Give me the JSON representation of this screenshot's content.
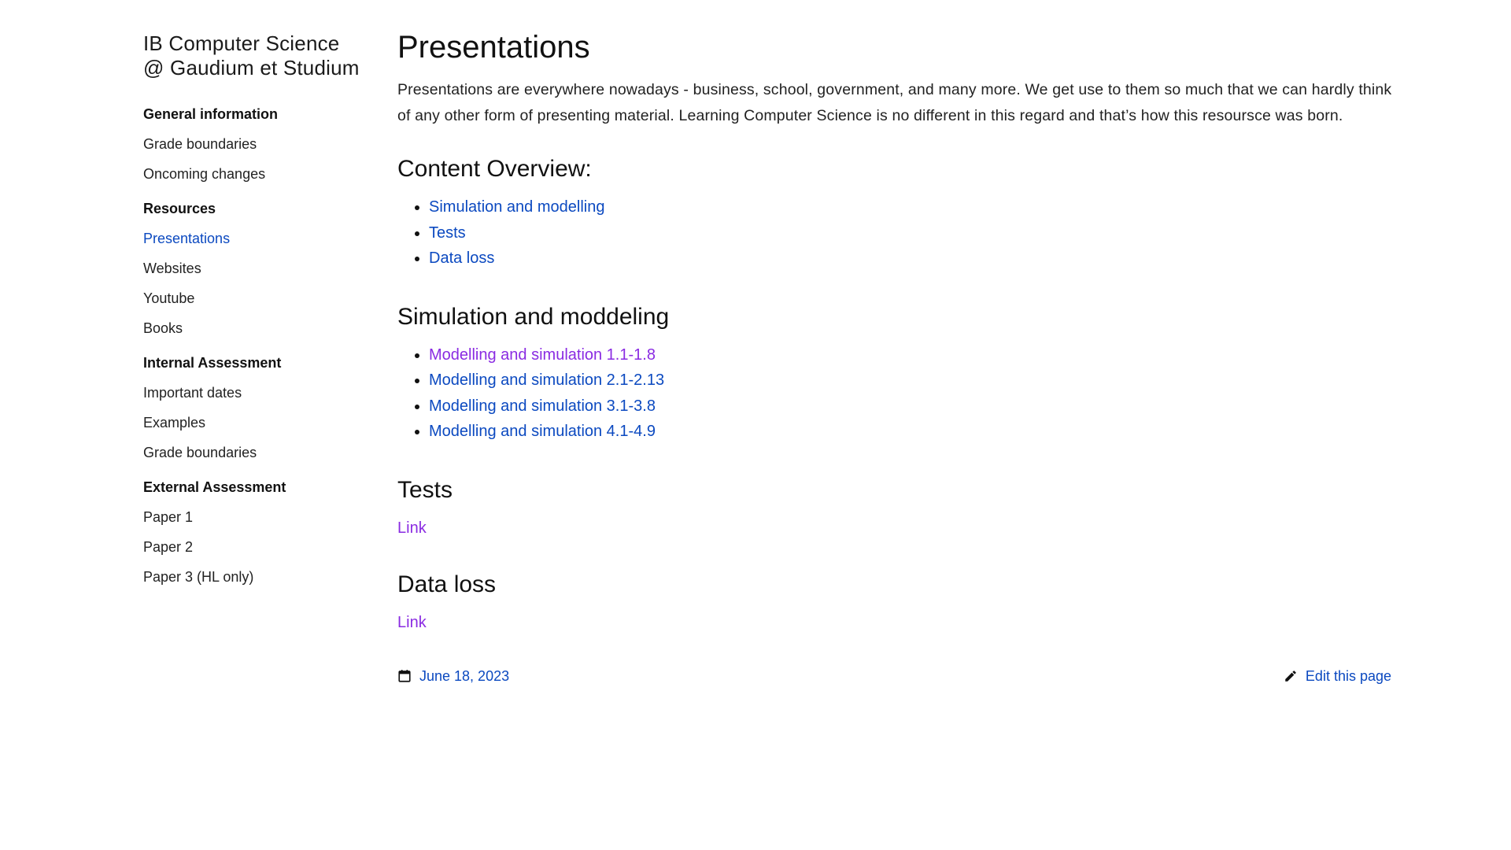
{
  "site": {
    "title_line1": "IB Computer Science",
    "title_line2": "@ Gaudium et Studium"
  },
  "sidebar": {
    "sections": [
      {
        "heading": "General information",
        "items": [
          "Grade boundaries",
          "Oncoming changes"
        ]
      },
      {
        "heading": "Resources",
        "items": [
          "Presentations",
          "Websites",
          "Youtube",
          "Books"
        ],
        "active_item": "Presentations"
      },
      {
        "heading": "Internal Assessment",
        "items": [
          "Important dates",
          "Examples",
          "Grade boundaries"
        ]
      },
      {
        "heading": "External Assessment",
        "items": [
          "Paper 1",
          "Paper 2",
          "Paper 3 (HL only)"
        ]
      }
    ]
  },
  "main": {
    "title": "Presentations",
    "intro": "Presentations are everywhere nowadays - business, school, government, and many more. We get use to them so much that we can hardly think of any other form of presenting material. Learning Computer Science is no different in this regard and that’s how this resoursce was born.",
    "overview": {
      "heading": "Content Overview:",
      "links": [
        "Simulation and modelling",
        "Tests",
        "Data loss"
      ]
    },
    "simulation": {
      "heading": "Simulation and moddeling",
      "links": [
        "Modelling and simulation 1.1-1.8",
        "Modelling and simulation 2.1-2.13",
        "Modelling and simulation 3.1-3.8",
        "Modelling and simulation 4.1-4.9"
      ]
    },
    "tests": {
      "heading": "Tests",
      "link": "Link"
    },
    "data_loss": {
      "heading": "Data loss",
      "link": "Link"
    }
  },
  "footer": {
    "date": "June 18, 2023",
    "edit": "Edit this page",
    "date_icon": "calendar-icon",
    "edit_icon": "pencil-icon"
  },
  "colors": {
    "link": "#0b49c0",
    "visited_link": "#8a2be2",
    "text": "#1a1a1a"
  }
}
